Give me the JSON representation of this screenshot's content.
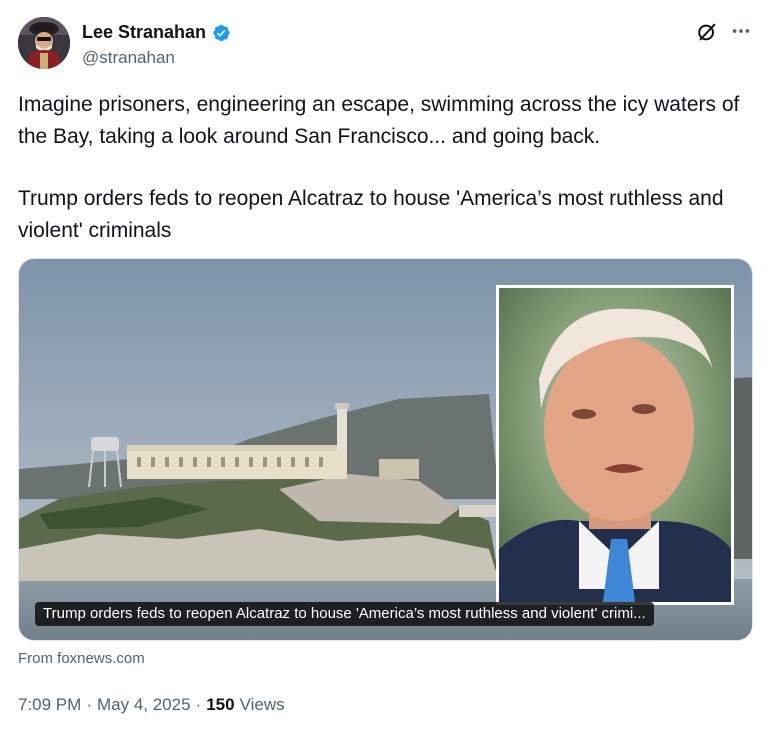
{
  "author": {
    "display_name": "Lee Stranahan",
    "handle": "@stranahan"
  },
  "post": {
    "paragraphs": [
      "Imagine prisoners, engineering an escape, swimming across the icy waters of the Bay, taking a look around San Francisco... and going back.",
      "Trump orders feds to reopen Alcatraz to house 'America’s most ruthless and violent' criminals"
    ]
  },
  "link_card": {
    "caption": "Trump orders feds to reopen Alcatraz to house 'America’s most ruthless and violent' crimi...",
    "source": "From foxnews.com"
  },
  "meta": {
    "time": "7:09 PM",
    "date": "May 4, 2025",
    "views_count": "150",
    "views_label": "Views"
  },
  "icons": {
    "verified": "verified-badge-icon",
    "grok": "grok-icon",
    "more": "more-icon"
  },
  "colors": {
    "verified_blue": "#1d9bf0",
    "secondary_text": "#536471",
    "primary_text": "#0f1419"
  }
}
